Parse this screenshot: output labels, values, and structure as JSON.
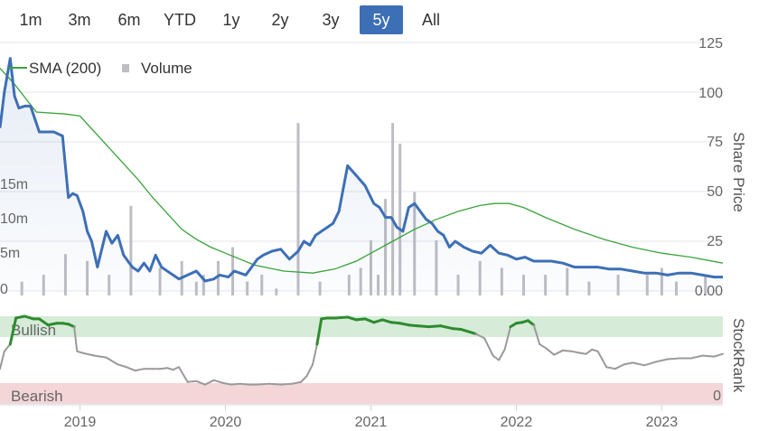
{
  "range_buttons": [
    {
      "label": "1m",
      "active": false
    },
    {
      "label": "3m",
      "active": false
    },
    {
      "label": "6m",
      "active": false
    },
    {
      "label": "YTD",
      "active": false
    },
    {
      "label": "1y",
      "active": false
    },
    {
      "label": "2y",
      "active": false
    },
    {
      "label": "3y",
      "active": false
    },
    {
      "label": "5y",
      "active": true
    },
    {
      "label": "All",
      "active": false
    }
  ],
  "colors": {
    "price": "#3d6fb6",
    "sma": "#3aa33a",
    "volume": "#bdbdc4",
    "bullish_band": "#d6ecd8",
    "bearish_band": "#f4d6d8",
    "bullish_text": "#3a8a3a",
    "bearish_text": "#c8454f",
    "rank_neutral": "#9a9a9a",
    "rank_bullish": "#2e8b2e",
    "rank_bearish": "#c8303d",
    "active_button": "#3d6fb6"
  },
  "chart_data": [
    {
      "type": "line",
      "legend": [
        "SMA (200)",
        "Volume"
      ],
      "legend_placement": "top-left",
      "y_axis_right": {
        "label": "Share Price",
        "ticks": [
          "125",
          "100",
          "75",
          "50",
          "25",
          "0.00"
        ],
        "min": 0,
        "max": 125
      },
      "y_axis_volume": {
        "ticks": [
          "15m",
          "10m",
          "5m",
          "0"
        ],
        "min": 0,
        "max": 30
      },
      "x_ticks": [
        "2019",
        "2020",
        "2021",
        "2022",
        "2023"
      ],
      "series": [
        {
          "name": "Share Price",
          "x": [
            2018.45,
            2018.48,
            2018.52,
            2018.55,
            2018.58,
            2018.62,
            2018.66,
            2018.72,
            2018.78,
            2018.82,
            2018.85,
            2018.88,
            2018.92,
            2018.95,
            2018.98,
            2019.02,
            2019.05,
            2019.08,
            2019.12,
            2019.18,
            2019.22,
            2019.26,
            2019.3,
            2019.33,
            2019.36,
            2019.4,
            2019.44,
            2019.48,
            2019.52,
            2019.56,
            2019.62,
            2019.68,
            2019.74,
            2019.8,
            2019.86,
            2019.92,
            2019.96,
            2020.02,
            2020.06,
            2020.1,
            2020.14,
            2020.18,
            2020.22,
            2020.26,
            2020.32,
            2020.38,
            2020.44,
            2020.5,
            2020.54,
            2020.58,
            2020.62,
            2020.66,
            2020.7,
            2020.74,
            2020.78,
            2020.84,
            2020.9,
            2020.96,
            2021.02,
            2021.06,
            2021.1,
            2021.14,
            2021.18,
            2021.22,
            2021.26,
            2021.3,
            2021.34,
            2021.38,
            2021.42,
            2021.46,
            2021.5,
            2021.54,
            2021.58,
            2021.64,
            2021.7,
            2021.76,
            2021.82,
            2021.88,
            2021.94,
            2022.0,
            2022.06,
            2022.12,
            2022.18,
            2022.24,
            2022.32,
            2022.4,
            2022.48,
            2022.56,
            2022.64,
            2022.72,
            2022.8,
            2022.88,
            2022.96,
            2023.04,
            2023.12,
            2023.2,
            2023.28,
            2023.36,
            2023.42
          ],
          "y": [
            82,
            100,
            117,
            98,
            92,
            93,
            93,
            80,
            80,
            80,
            79,
            78,
            47,
            49,
            48,
            40,
            30,
            25,
            12,
            30,
            24,
            28,
            18,
            15,
            12,
            10,
            14,
            10,
            18,
            12,
            9,
            6,
            8,
            10,
            5,
            6,
            8,
            7,
            10,
            9,
            8,
            12,
            16,
            18,
            20,
            21,
            16,
            20,
            25,
            23,
            28,
            30,
            32,
            34,
            40,
            63,
            58,
            53,
            44,
            42,
            37,
            37,
            32,
            30,
            42,
            44,
            40,
            36,
            34,
            30,
            28,
            22,
            25,
            22,
            20,
            19,
            23,
            19,
            18,
            16,
            17,
            15,
            15,
            15,
            14,
            12,
            12,
            12,
            11,
            11,
            10,
            9,
            9,
            8,
            9,
            9,
            8,
            7,
            7
          ]
        },
        {
          "name": "SMA (200)",
          "x": [
            2018.45,
            2018.55,
            2018.7,
            2018.9,
            2019.0,
            2019.1,
            2019.2,
            2019.3,
            2019.4,
            2019.5,
            2019.6,
            2019.7,
            2019.8,
            2019.9,
            2020.0,
            2020.2,
            2020.4,
            2020.6,
            2020.75,
            2020.9,
            2021.0,
            2021.15,
            2021.3,
            2021.45,
            2021.6,
            2021.75,
            2021.85,
            2021.95,
            2022.05,
            2022.2,
            2022.4,
            2022.6,
            2022.8,
            2023.0,
            2023.2,
            2023.42
          ],
          "y": [
            112,
            104,
            90,
            89,
            88,
            80,
            72,
            64,
            56,
            47,
            39,
            31,
            26,
            22,
            19,
            13,
            10,
            9,
            11,
            15,
            19,
            25,
            31,
            36,
            40,
            43,
            44,
            44,
            42,
            37,
            31,
            26,
            22,
            19,
            17,
            14
          ]
        }
      ],
      "volume_series": {
        "name": "Volume",
        "x": [
          2018.6,
          2018.75,
          2018.9,
          2019.05,
          2019.2,
          2019.35,
          2019.55,
          2019.7,
          2019.8,
          2019.85,
          2019.95,
          2020.05,
          2020.15,
          2020.25,
          2020.35,
          2020.5,
          2020.65,
          2020.85,
          2020.93,
          2021.0,
          2021.05,
          2021.1,
          2021.15,
          2021.2,
          2021.3,
          2021.45,
          2021.6,
          2021.75,
          2021.9,
          2022.05,
          2022.2,
          2022.35,
          2022.5,
          2022.7,
          2022.9,
          2023.0,
          2023.1,
          2023.3
        ],
        "y": [
          2,
          3,
          6,
          5,
          3,
          13,
          4,
          5,
          2,
          3,
          5,
          7,
          2,
          3,
          1,
          25,
          2,
          3,
          4,
          8,
          3,
          14,
          25,
          22,
          15,
          8,
          3,
          5,
          4,
          3,
          3,
          4,
          2,
          3,
          3,
          4,
          2,
          3
        ]
      }
    },
    {
      "type": "line",
      "y_axis_right": {
        "label": "StockRank",
        "ticks": [
          "0"
        ],
        "min": 0,
        "max": 100
      },
      "bands": [
        {
          "label": "Bullish",
          "from": 80,
          "to": 100
        },
        {
          "label": "Bearish",
          "from": 0,
          "to": 20
        }
      ],
      "series": [
        {
          "name": "StockRank",
          "x": [
            2018.45,
            2018.48,
            2018.52,
            2018.56,
            2018.62,
            2018.68,
            2018.72,
            2018.78,
            2018.84,
            2018.88,
            2018.92,
            2018.96,
            2018.98,
            2019.02,
            2019.1,
            2019.18,
            2019.26,
            2019.32,
            2019.38,
            2019.44,
            2019.5,
            2019.55,
            2019.6,
            2019.64,
            2019.68,
            2019.74,
            2019.8,
            2019.86,
            2019.92,
            2019.98,
            2020.04,
            2020.1,
            2020.16,
            2020.22,
            2020.3,
            2020.38,
            2020.46,
            2020.52,
            2020.56,
            2020.6,
            2020.63,
            2020.66,
            2020.7,
            2020.76,
            2020.84,
            2020.9,
            2020.96,
            2021.02,
            2021.08,
            2021.14,
            2021.2,
            2021.26,
            2021.32,
            2021.4,
            2021.48,
            2021.56,
            2021.62,
            2021.68,
            2021.72,
            2021.78,
            2021.84,
            2021.88,
            2021.92,
            2021.96,
            2022.0,
            2022.04,
            2022.08,
            2022.12,
            2022.16,
            2022.2,
            2022.26,
            2022.32,
            2022.38,
            2022.44,
            2022.48,
            2022.52,
            2022.56,
            2022.62,
            2022.68,
            2022.74,
            2022.8,
            2022.88,
            2022.96,
            2023.04,
            2023.12,
            2023.2,
            2023.28,
            2023.36,
            2023.42
          ],
          "y": [
            40,
            60,
            68,
            98,
            100,
            97,
            97,
            90,
            92,
            92,
            91,
            88,
            60,
            58,
            55,
            53,
            45,
            42,
            38,
            40,
            40,
            40,
            41,
            39,
            42,
            25,
            26,
            22,
            27,
            24,
            22,
            23,
            22,
            22,
            23,
            22,
            23,
            25,
            32,
            45,
            68,
            97,
            98,
            98,
            99,
            96,
            97,
            93,
            96,
            93,
            92,
            90,
            89,
            88,
            89,
            86,
            85,
            82,
            80,
            75,
            55,
            50,
            62,
            88,
            92,
            93,
            95,
            90,
            68,
            64,
            56,
            61,
            60,
            58,
            57,
            62,
            60,
            42,
            40,
            45,
            47,
            44,
            48,
            51,
            52,
            52,
            55,
            54,
            57
          ]
        }
      ]
    }
  ]
}
